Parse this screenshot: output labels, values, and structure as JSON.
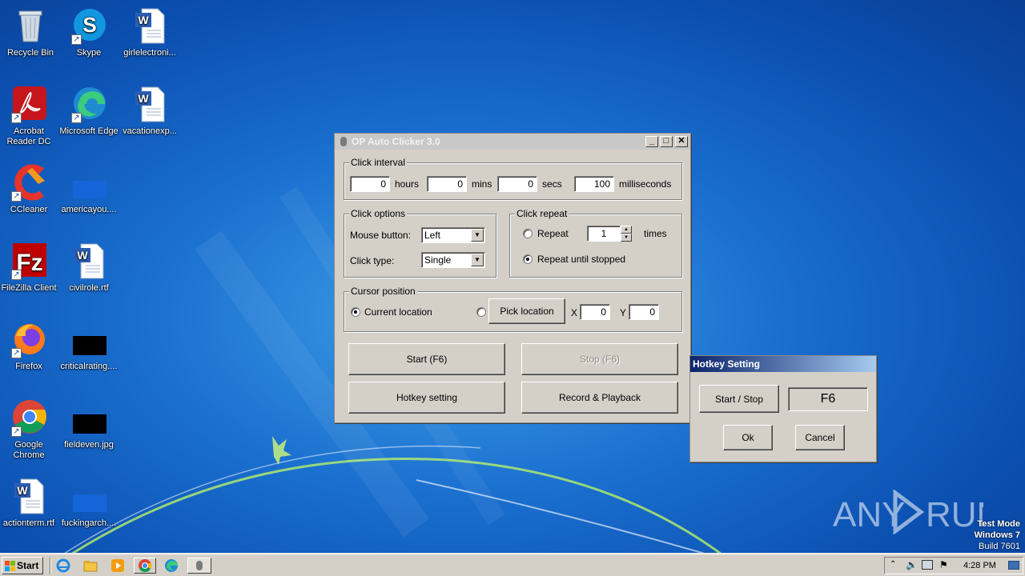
{
  "desktop": {
    "icons": [
      {
        "label": "Recycle Bin",
        "icon": "recycle-bin-icon"
      },
      {
        "label": "Skype",
        "icon": "skype-icon"
      },
      {
        "label": "girlelectroni...",
        "icon": "word-document-icon"
      },
      {
        "label": "Acrobat Reader DC",
        "icon": "acrobat-icon"
      },
      {
        "label": "Microsoft Edge",
        "icon": "edge-icon"
      },
      {
        "label": "vacationexp...",
        "icon": "word-document-icon"
      },
      {
        "label": "CCleaner",
        "icon": "ccleaner-icon"
      },
      {
        "label": "americayou....",
        "icon": "blue-file-icon"
      },
      {
        "label": "FileZilla Client",
        "icon": "filezilla-icon"
      },
      {
        "label": "civilrole.rtf",
        "icon": "word-document-icon"
      },
      {
        "label": "Firefox",
        "icon": "firefox-icon"
      },
      {
        "label": "criticalrating....",
        "icon": "black-file-icon"
      },
      {
        "label": "Google Chrome",
        "icon": "chrome-icon"
      },
      {
        "label": "fieldeven.jpg",
        "icon": "black-file-icon"
      },
      {
        "label": "actionterm.rtf",
        "icon": "word-document-icon"
      },
      {
        "label": "fuckingarch....",
        "icon": "blue-file-icon"
      }
    ]
  },
  "main_window": {
    "title": "OP Auto Clicker 3.0",
    "click_interval": {
      "legend": "Click interval",
      "hours_value": "0",
      "hours_label": "hours",
      "mins_value": "0",
      "mins_label": "mins",
      "secs_value": "0",
      "secs_label": "secs",
      "ms_value": "100",
      "ms_label": "milliseconds"
    },
    "click_options": {
      "legend": "Click options",
      "mouse_button_label": "Mouse button:",
      "mouse_button_value": "Left",
      "click_type_label": "Click type:",
      "click_type_value": "Single"
    },
    "click_repeat": {
      "legend": "Click repeat",
      "repeat_label": "Repeat",
      "repeat_value": "1",
      "times_label": "times",
      "until_stopped_label": "Repeat until stopped",
      "selected": "until_stopped"
    },
    "cursor_position": {
      "legend": "Cursor position",
      "current_location_label": "Current location",
      "pick_location_label": "Pick location",
      "x_label": "X",
      "x_value": "0",
      "y_label": "Y",
      "y_value": "0",
      "selected": "current"
    },
    "buttons": {
      "start": "Start (F6)",
      "stop": "Stop (F6)",
      "hotkey": "Hotkey setting",
      "record": "Record & Playback"
    }
  },
  "hotkey_dialog": {
    "title": "Hotkey Setting",
    "start_stop_label": "Start / Stop",
    "hotkey_value": "F6",
    "ok_label": "Ok",
    "cancel_label": "Cancel"
  },
  "taskbar": {
    "start_label": "Start",
    "clock": "4:28 PM",
    "pinned": [
      "internet-explorer-icon",
      "file-explorer-icon",
      "media-player-icon",
      "chrome-icon",
      "edge-icon",
      "auto-clicker-icon"
    ]
  },
  "watermark": {
    "brand": "ANY RUN",
    "line1": "Test Mode",
    "line2": "Windows 7",
    "line3": "Build 7601"
  },
  "colors": {
    "dialog_face": "#d4d0c8",
    "active_title_start": "#0a246a",
    "active_title_end": "#a6caf0",
    "desktop_blue": "#1a6fcf"
  }
}
